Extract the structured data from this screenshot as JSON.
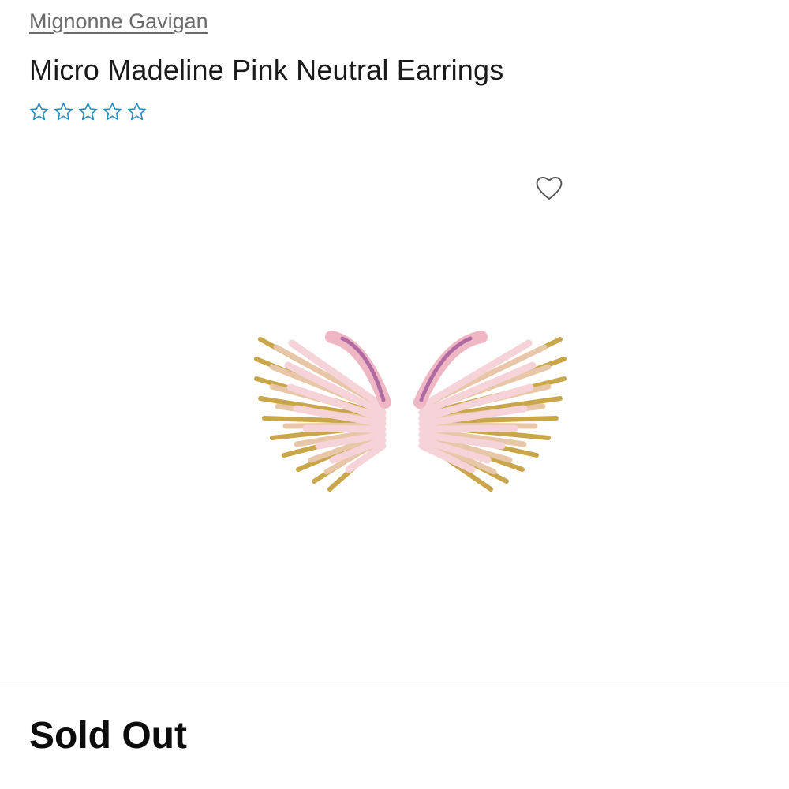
{
  "product": {
    "brand": "Mignonne Gavigan",
    "title": "Micro Madeline Pink Neutral Earrings",
    "rating": {
      "stars_total": 5,
      "stars_filled": 0,
      "star_color": "#2a8bbf",
      "star_icon": "star-outline-icon"
    },
    "favorite_icon": "heart-outline-icon",
    "image": {
      "subject": "pink and gold beaded wing stud earrings"
    },
    "status": "Sold Out"
  },
  "colors": {
    "brand_link": "#6a6a6a",
    "title": "#1a1a1a",
    "accent_star": "#2a8bbf",
    "divider": "#e6e6e6",
    "status": "#0c0c0c"
  }
}
